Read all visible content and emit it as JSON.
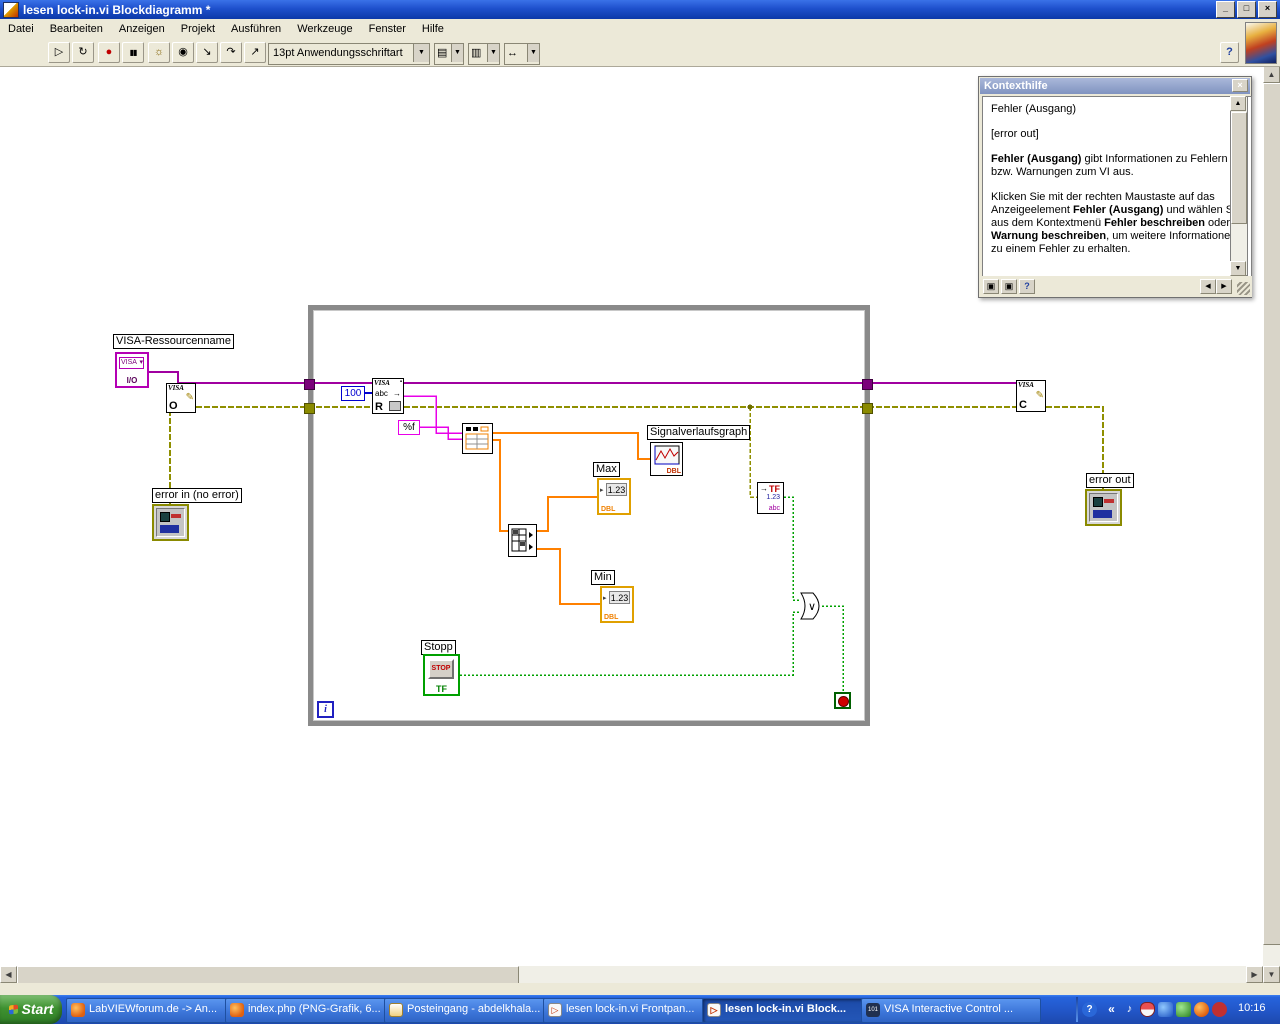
{
  "titlebar": {
    "title": "lesen lock-in.vi Blockdiagramm *",
    "controls": {
      "minimize": "_",
      "maximize": "□",
      "close": "×"
    }
  },
  "menu": {
    "items": [
      "Datei",
      "Bearbeiten",
      "Anzeigen",
      "Projekt",
      "Ausführen",
      "Werkzeuge",
      "Fenster",
      "Hilfe"
    ]
  },
  "toolbar": {
    "font_selector": "13pt Anwendungsschriftart",
    "help_label": "?",
    "glyphs": {
      "run": "▷",
      "run_continuous": "↻",
      "abort": "●",
      "pause": "▮▮",
      "highlight": "☼",
      "retain": "◉",
      "step_into": "↘",
      "step_over": "↷",
      "step_out": "↗",
      "combo_arrow": "▼",
      "align": "▤",
      "distribute": "▥",
      "resize": "↔"
    }
  },
  "context_help": {
    "title": "Kontexthilfe",
    "heading": "Fehler (Ausgang)",
    "subheading": "[error out]",
    "para1": [
      {
        "t": "Fehler (Ausgang)"
      },
      {
        "t": " gibt Informationen zu Fehlern bzw. Warnungen zum VI aus."
      }
    ],
    "para2": [
      {
        "t": "Klicken Sie mit der rechten Maustaste auf das Anzeigeelement "
      },
      {
        "t": "Fehler (Ausgang)"
      },
      {
        "t": " und wählen Sie aus dem Kontextmenü "
      },
      {
        "t": "Fehler beschreiben"
      },
      {
        "t": " oder "
      },
      {
        "t": "Warnung beschreiben"
      },
      {
        "t": ", um weitere Informationen zu einem Fehler zu erhalten."
      }
    ],
    "buttons": {
      "pin": "▣",
      "help": "?",
      "nav_left": "◀",
      "nav_right": "▶"
    }
  },
  "diagram": {
    "labels": {
      "visa_resource": "VISA-Ressourcenname",
      "signal_graph": "Signalverlaufsgraph",
      "max": "Max",
      "min": "Min",
      "stop": "Stopp",
      "error_in": "error in (no error)",
      "error_out": "error out"
    },
    "constants": {
      "bytes_count": "100",
      "format_string": "%f"
    },
    "nodes": {
      "visa": "VISA",
      "io": "I/O",
      "open_letter": "O",
      "read_letter": "R",
      "close_letter": "C",
      "abc": "abc",
      "dbl": "DBL",
      "value": "1.23",
      "stop_text": "STOP",
      "tf": "TF",
      "iteration": "i",
      "or_symbol": "∨",
      "drop_arrow": "▾",
      "inc_arrow": "▸",
      "pencil": "✎",
      "arrow_right": "→",
      "square": "▪"
    }
  },
  "scroll": {
    "up": "▲",
    "down": "▼",
    "left": "◀",
    "right": "▶"
  },
  "taskbar": {
    "start_label": "Start",
    "buttons": [
      {
        "label": "LabVIEWforum.de -> An..."
      },
      {
        "label": "index.php (PNG-Grafik, 6..."
      },
      {
        "label": "Posteingang - abdelkhala..."
      },
      {
        "label": "lesen lock-in.vi Frontpan..."
      },
      {
        "label": "lesen lock-in.vi Block..."
      },
      {
        "label": "VISA Interactive Control ..."
      }
    ],
    "tray": {
      "help": "?",
      "chevron": "«",
      "volume": "♪",
      "clock": "10:16"
    }
  }
}
